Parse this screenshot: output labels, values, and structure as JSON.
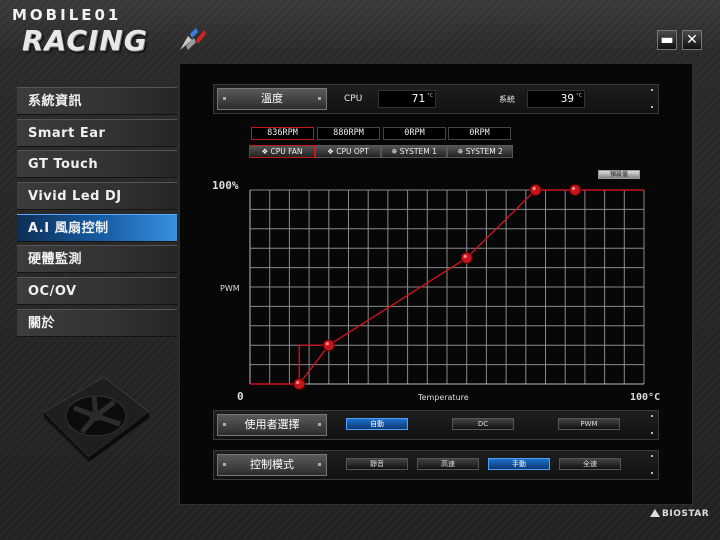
{
  "watermark": "MOBILE01",
  "app": {
    "logo": "RACING"
  },
  "window_controls": {
    "minimize": "▬",
    "close": "✕"
  },
  "sidebar": {
    "items": [
      {
        "label": "系統資訊"
      },
      {
        "label": "Smart Ear"
      },
      {
        "label": "GT Touch"
      },
      {
        "label": "Vivid Led DJ"
      },
      {
        "label": "A.I 風扇控制",
        "active": true
      },
      {
        "label": "硬體監測"
      },
      {
        "label": "OC/OV"
      },
      {
        "label": "關於"
      }
    ]
  },
  "sensors": {
    "button_label": "溫度",
    "cpu_label": "CPU",
    "cpu_value": "71",
    "system_label": "系統",
    "system_value": "39",
    "unit": "°C"
  },
  "fans": [
    {
      "rpm": "836RPM",
      "name": "CPU FAN",
      "selected": true
    },
    {
      "rpm": "880RPM",
      "name": "CPU OPT"
    },
    {
      "rpm": "0RPM",
      "name": "SYSTEM 1"
    },
    {
      "rpm": "0RPM",
      "name": "SYSTEM 2"
    }
  ],
  "default_button": "預設值",
  "chart_data": {
    "type": "line",
    "xlabel": "Temperature",
    "ylabel": "PWM",
    "x_tick_labels": [
      "0",
      "100°C"
    ],
    "y_tick_labels": [
      "100%"
    ],
    "xlim": [
      0,
      100
    ],
    "ylim": [
      0,
      100
    ],
    "grid": true,
    "series": [
      {
        "points": [
          [
            0,
            0
          ],
          [
            12.5,
            0
          ],
          [
            20,
            20
          ],
          [
            55,
            65
          ],
          [
            72.5,
            100
          ],
          [
            82.5,
            100
          ],
          [
            100,
            100
          ]
        ]
      }
    ],
    "control_points": [
      [
        12.5,
        0
      ],
      [
        20,
        20
      ],
      [
        55,
        65
      ],
      [
        72.5,
        100
      ],
      [
        82.5,
        100
      ]
    ],
    "line_color": "#c8141c"
  },
  "user_select": {
    "label": "使用者選擇",
    "options": [
      {
        "label": "自動",
        "selected": true
      },
      {
        "label": "DC"
      },
      {
        "label": "PWM"
      }
    ]
  },
  "control_mode": {
    "label": "控制模式",
    "options": [
      {
        "label": "靜音"
      },
      {
        "label": "高速"
      },
      {
        "label": "手動",
        "selected": true
      },
      {
        "label": "全速"
      }
    ]
  },
  "brand": "BIOSTAR",
  "colors": {
    "accent_blue": "#1e70c8",
    "accent_red": "#c8141c"
  }
}
